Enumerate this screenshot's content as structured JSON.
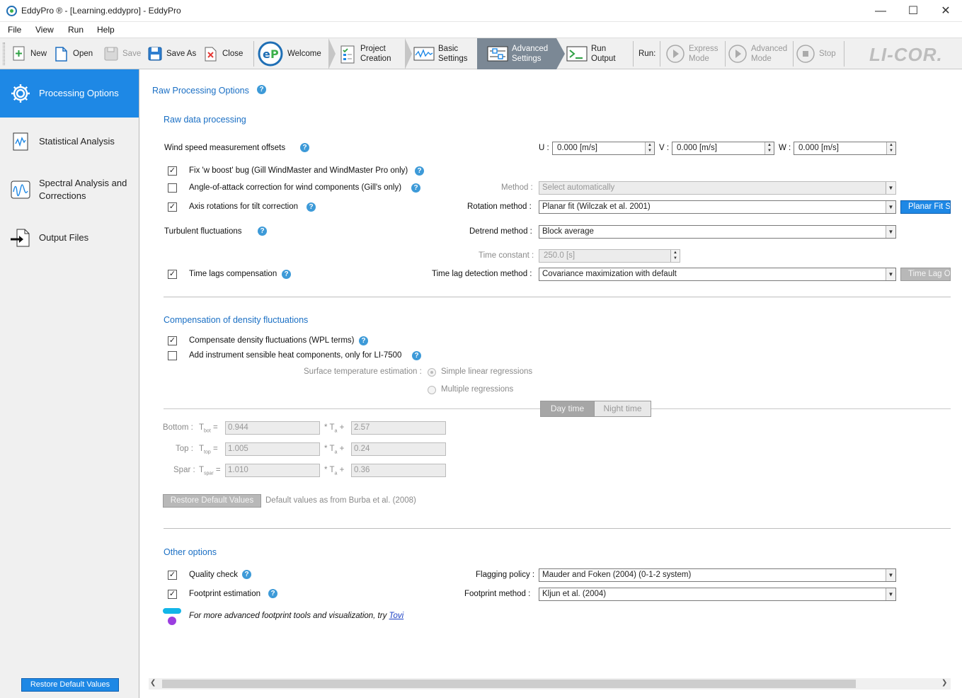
{
  "window": {
    "title": "EddyPro ® - [Learning.eddypro] - EddyPro",
    "minimize": "—",
    "maximize": "☐",
    "close": "✕"
  },
  "menu": [
    "File",
    "View",
    "Run",
    "Help"
  ],
  "toolbar": {
    "new": "New",
    "open": "Open",
    "save": "Save",
    "save_as": "Save As",
    "close": "Close",
    "steps": {
      "welcome": "Welcome",
      "project_creation": [
        "Project",
        "Creation"
      ],
      "basic_settings": [
        "Basic",
        "Settings"
      ],
      "advanced_settings": [
        "Advanced",
        "Settings"
      ],
      "run_output": [
        "Run",
        "Output"
      ]
    },
    "run_label": "Run:",
    "express_mode": [
      "Express",
      "Mode"
    ],
    "advanced_mode": [
      "Advanced",
      "Mode"
    ],
    "stop": "Stop",
    "brand": "LI-COR."
  },
  "sidebar": {
    "items": [
      {
        "label": "Processing Options",
        "icon": "gear-icon",
        "active": true
      },
      {
        "label": "Statistical Analysis",
        "icon": "chart-icon",
        "active": false
      },
      {
        "label": "Spectral Analysis and Corrections",
        "icon": "spectral-icon",
        "active": false
      },
      {
        "label": "Output Files",
        "icon": "export-icon",
        "active": false
      }
    ],
    "restore_button": "Restore Default Values"
  },
  "main": {
    "page_title": "Raw Processing Options",
    "raw_data": {
      "section_title": "Raw data processing",
      "wind_offsets_label": "Wind speed measurement offsets",
      "u_label": "U :",
      "v_label": "V :",
      "w_label": "W :",
      "u_value": "0.000  [m/s]",
      "v_value": "0.000  [m/s]",
      "w_value": "0.000  [m/s]",
      "fix_w_boost": "Fix 'w boost' bug (Gill WindMaster and WindMaster Pro only)",
      "aoa_correction": "Angle-of-attack correction for wind components (Gill's only)",
      "method_label": "Method :",
      "method_value": "Select automatically",
      "axis_rotations": "Axis rotations for tilt correction",
      "rotation_method_label": "Rotation method :",
      "rotation_method_value": "Planar fit (Wilczak et al. 2001)",
      "planar_fit_button": "Planar Fit Settings...",
      "turbulent_label": "Turbulent fluctuations",
      "detrend_label": "Detrend method :",
      "detrend_value": "Block average",
      "time_constant_label": "Time constant :",
      "time_constant_value": "250.0  [s]",
      "time_lags": "Time lags compensation",
      "time_lag_method_label": "Time lag detection method :",
      "time_lag_method_value": "Covariance maximization with default",
      "time_lag_button": "Time Lag Optimization..."
    },
    "density": {
      "section_title": "Compensation of density fluctuations",
      "wpl": "Compensate density fluctuations (WPL terms)",
      "sensible_heat": "Add instrument sensible heat components, only for LI-7500",
      "surface_temp_label": "Surface temperature estimation :",
      "simple_linear": "Simple linear regressions",
      "multiple": "Multiple regressions",
      "day_time": "Day time",
      "night_time": "Night time",
      "rows": [
        {
          "label": "Bottom :",
          "sym": "T",
          "sub": "bot",
          "a": "0.944",
          "b": "2.57"
        },
        {
          "label": "Top :",
          "sym": "T",
          "sub": "top",
          "a": "1.005",
          "b": "0.24"
        },
        {
          "label": "Spar :",
          "sym": "T",
          "sub": "spar",
          "a": "1.010",
          "b": "0.36"
        }
      ],
      "eq_mid": "* T",
      "eq_mid_sub": "a",
      "restore_button": "Restore Default Values",
      "restore_note": "Default values as from Burba et al. (2008)"
    },
    "other": {
      "section_title": "Other options",
      "quality_check": "Quality check",
      "flagging_label": "Flagging policy :",
      "flagging_value": "Mauder and Foken (2004) (0-1-2 system)",
      "footprint": "Footprint estimation",
      "footprint_method_label": "Footprint method :",
      "footprint_method_value": "Kljun et al. (2004)",
      "tovi_text": "For more advanced footprint tools and visualization, try",
      "tovi_link": "Tovi"
    }
  },
  "colors": {
    "accent": "#1e88e5",
    "section_title": "#1a6fc4",
    "toolbar_active": "#7b8895"
  }
}
